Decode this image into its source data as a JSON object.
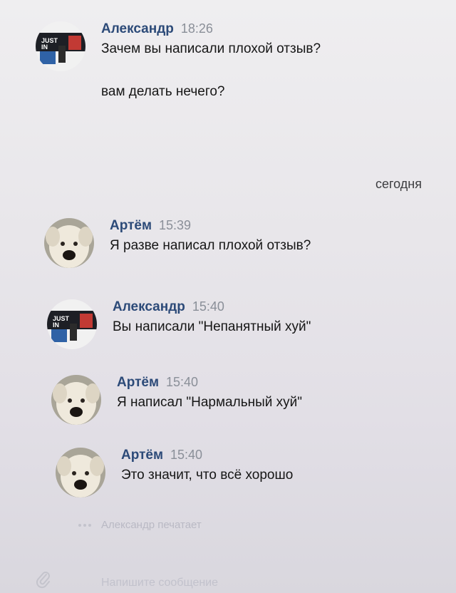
{
  "messages": [
    {
      "author": "Александр",
      "time": "18:26",
      "avatar": "game-logo-avatar",
      "lines": [
        "Зачем вы написали плохой отзыв?",
        "вам делать нечего?"
      ]
    },
    {
      "author": "Артём",
      "time": "15:39",
      "avatar": "dog-avatar",
      "lines": [
        "Я разве написал плохой отзыв?"
      ]
    },
    {
      "author": "Александр",
      "time": "15:40",
      "avatar": "game-logo-avatar",
      "lines": [
        "Вы написали \"Непанятный хуй\""
      ]
    },
    {
      "author": "Артём",
      "time": "15:40",
      "avatar": "dog-avatar",
      "lines": [
        "Я написал \"Нармальный хуй\""
      ]
    },
    {
      "author": "Артём",
      "time": "15:40",
      "avatar": "dog-avatar",
      "lines": [
        "Это значит, что всё хорошо"
      ]
    }
  ],
  "date_separator": "сегодня",
  "typing_indicator": "Александр печатает",
  "composer": {
    "placeholder": "Напишите сообщение"
  },
  "colors": {
    "author_name": "#2c4a78",
    "time": "#8a8f98",
    "background": "#e9e7ec"
  }
}
